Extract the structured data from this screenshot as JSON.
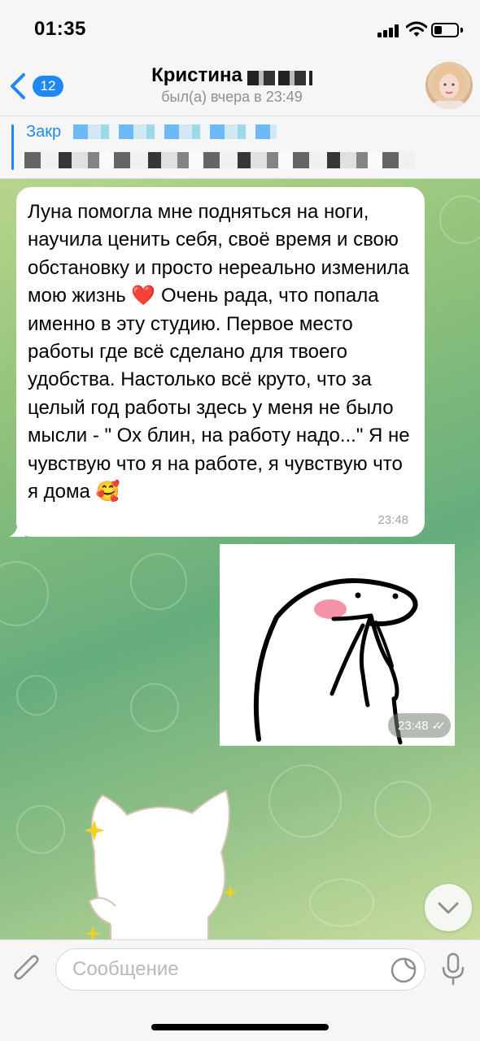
{
  "status_bar": {
    "time": "01:35",
    "icons": [
      "cellular-signal-icon",
      "wifi-icon",
      "battery-icon"
    ]
  },
  "header": {
    "back_badge": "12",
    "contact_name": "Кристина",
    "last_seen": "был(а) вчера в 23:49",
    "back_icon": "chevron-left-icon",
    "avatar_icon": "contact-avatar"
  },
  "pinned": {
    "title": "Закр"
  },
  "messages": [
    {
      "direction": "incoming",
      "type": "text",
      "text": "Луна помогла мне подняться на ноги, научила ценить себя, своё время и свою обстановку и просто нереально изменила мою жизнь ❤️ Очень рада, что попала именно в эту студию. Первое место работы где всё сделано для твоего удобства. Настолько всё круто, что за целый год работы здесь у меня не было мысли - \" Ох блин, на работу надо...\" Я не чувствую что я на работе, я чувствую что я дома 🥰",
      "time": "23:48"
    },
    {
      "direction": "outgoing",
      "type": "sticker",
      "sticker": "blushing-doodle-sticker",
      "time": "23:48",
      "status_icon": "double-check-icon"
    },
    {
      "direction": "incoming",
      "type": "sticker",
      "sticker": "white-cat-sparkles-sticker"
    }
  ],
  "composer": {
    "placeholder": "Сообщение",
    "value": "",
    "attach_icon": "paperclip-icon",
    "sticker_icon": "sticker-icon",
    "mic_icon": "microphone-icon",
    "scroll_icon": "chevron-down-icon"
  },
  "colors": {
    "accent": "#1e88f5",
    "bubble_incoming": "#ffffff",
    "bar_background": "#f6f6f6",
    "wallpaper_start": "#b7d58c",
    "wallpaper_mid": "#66ad7d",
    "wallpaper_end": "#c9dd9e"
  }
}
